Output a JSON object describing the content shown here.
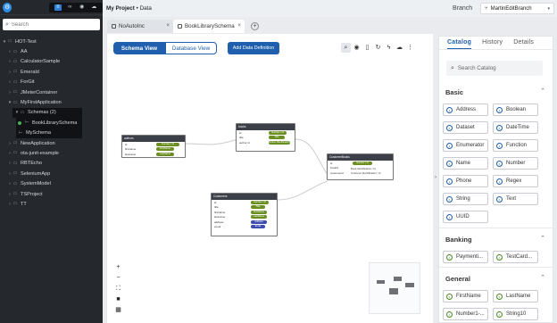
{
  "sidebar": {
    "search_placeholder": "Search",
    "tree": [
      {
        "label": "HOT-Test",
        "caret": "▾",
        "indent": 0
      },
      {
        "label": "AA",
        "caret": "›",
        "indent": 1
      },
      {
        "label": "CalculatorSample",
        "caret": "›",
        "indent": 1
      },
      {
        "label": "Emerald",
        "caret": "›",
        "indent": 1
      },
      {
        "label": "ForGit",
        "caret": "›",
        "indent": 1
      },
      {
        "label": "JMeterContainer",
        "caret": "›",
        "indent": 1
      },
      {
        "label": "MyFirstApplication",
        "caret": "▾",
        "indent": 1
      },
      {
        "label": "Schemas (2)",
        "caret": "▾",
        "indent": 2
      },
      {
        "label": "BookLibrarySchema",
        "caret": "",
        "indent": 3
      },
      {
        "label": "MySchema",
        "caret": "",
        "indent": 3
      },
      {
        "label": "NewApplication",
        "caret": "›",
        "indent": 1
      },
      {
        "label": "ota-junit-example",
        "caret": "›",
        "indent": 1
      },
      {
        "label": "RBTEcho",
        "caret": "›",
        "indent": 1
      },
      {
        "label": "SeleniumApp",
        "caret": "›",
        "indent": 1
      },
      {
        "label": "SystemModel",
        "caret": "›",
        "indent": 1
      },
      {
        "label": "TSProject",
        "caret": "›",
        "indent": 1
      },
      {
        "label": "TT",
        "caret": "›",
        "indent": 1
      }
    ]
  },
  "header": {
    "project": "My Project",
    "separator": "•",
    "section": "Data",
    "branch_label": "Branch",
    "branch_value": "MartinEditBranch"
  },
  "tabs": [
    {
      "label": "NoAutoInc"
    },
    {
      "label": "BookLibrarySchema"
    }
  ],
  "canvas": {
    "schema_view": "Schema View",
    "database_view": "Database View",
    "add_definition": "Add Data Definition"
  },
  "right_panel": {
    "tabs": [
      "Catalog",
      "History",
      "Details"
    ],
    "search_placeholder": "Search Catalog",
    "sections": [
      {
        "title": "Basic",
        "items": [
          "Address",
          "Boolean",
          "Dataset",
          "DateTime",
          "Enumerator",
          "Function",
          "Name",
          "Number",
          "Phone",
          "Regex",
          "String",
          "Text",
          "UUID"
        ]
      },
      {
        "title": "Banking",
        "items": [
          "Paymenti...",
          "TestCard..."
        ]
      },
      {
        "title": "General",
        "items": [
          "FirstName",
          "LastName",
          "Number1-...",
          "String10"
        ]
      }
    ]
  },
  "diagram": {
    "nodes": [
      {
        "title": "authors",
        "rows": [
          [
            "id",
            "Number / Id"
          ],
          [
            "firstname",
            "FirstName"
          ],
          [
            "lastname",
            "LastName"
          ]
        ]
      },
      {
        "title": "books",
        "rows": [
          [
            "id",
            "Number / Id"
          ],
          [
            "title",
            "Title"
          ],
          [
            "author id",
            "Author Identification"
          ]
        ]
      },
      {
        "title": "CustomerBooks",
        "rows": [
          [
            "id",
            "Number / Id"
          ],
          [
            "bookid",
            "Book Identification / Id"
          ],
          [
            "customerid",
            "Customer Identification / Id"
          ]
        ]
      },
      {
        "title": "Customers",
        "rows": [
          [
            "id",
            "Number / Id"
          ],
          [
            "title",
            "Title"
          ],
          [
            "firstname",
            "FirstName"
          ],
          [
            "lastname",
            "LastName"
          ],
          [
            "address",
            "Address"
          ],
          [
            "email",
            "Email"
          ]
        ]
      }
    ]
  },
  "colors": {
    "accent": "#1f5fad",
    "sidebar_bg": "#25282c",
    "pill_green": "#6a8e20",
    "pill_blue": "#3b4bb0"
  }
}
